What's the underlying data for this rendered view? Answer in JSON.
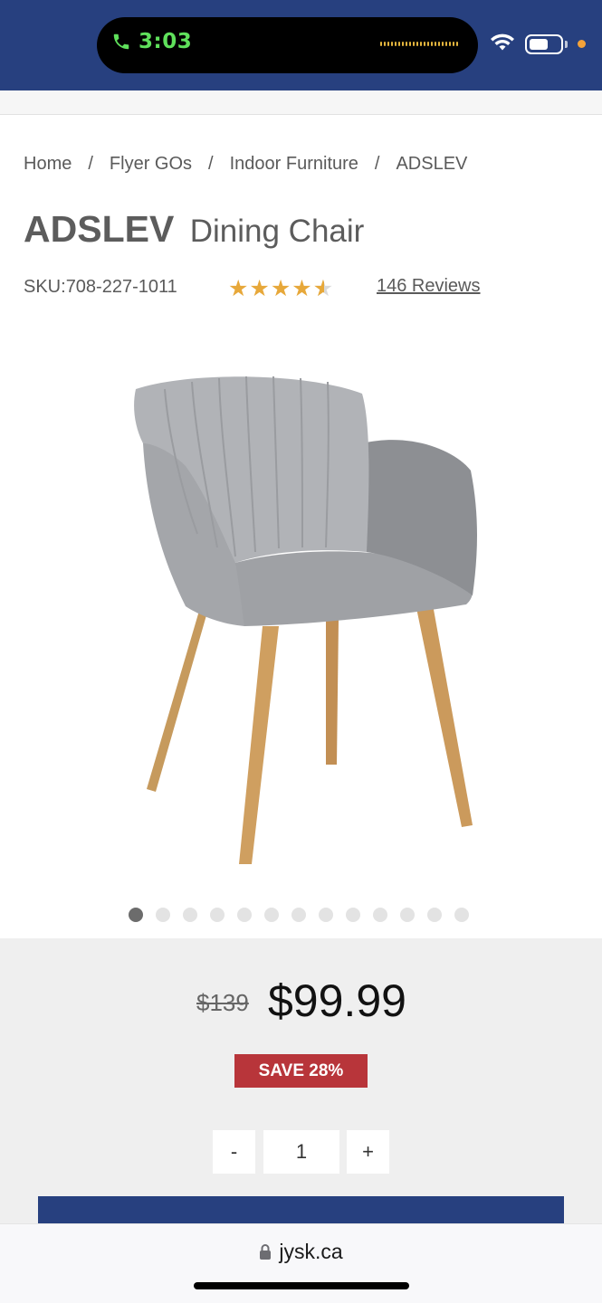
{
  "status": {
    "time": "3:03"
  },
  "breadcrumb": {
    "items": [
      "Home",
      "Flyer GOs",
      "Indoor Furniture",
      "ADSLEV"
    ],
    "separator": "/"
  },
  "product": {
    "name_bold": "ADSLEV",
    "name_sub": "Dining Chair",
    "sku_label": "SKU:",
    "sku_value": "708-227-1011",
    "rating": 4.5,
    "reviews": "146 Reviews",
    "image_icon": "chair-image",
    "image_count": 13,
    "active_image": 1
  },
  "pricing": {
    "old_price": "$139",
    "new_price": "$99.99",
    "save_label": "SAVE 28%"
  },
  "quantity": {
    "minus": "-",
    "value": "1",
    "plus": "+"
  },
  "browser": {
    "url": "jysk.ca"
  },
  "colors": {
    "brand_blue": "#27407f",
    "save_red": "#b8353a",
    "star_gold": "#e7a83a"
  }
}
